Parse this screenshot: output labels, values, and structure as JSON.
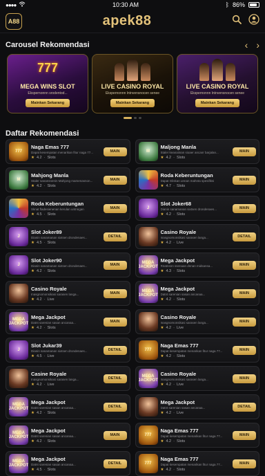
{
  "status_bar": {
    "time": "10:30 AM",
    "battery": "86%"
  },
  "header": {
    "logo_text": "A88",
    "brand": "apek88"
  },
  "carousel": {
    "title": "Carousel Rekomendasi",
    "slides": [
      {
        "title": "MEGA WINS SLOT",
        "subtitle": "Ekspernonnn srodentod...",
        "button": "Mainkan Sekarang",
        "art_text": "777",
        "theme": "slot"
      },
      {
        "title": "LIVE CASINO ROYAL",
        "subtitle": "Ekspernonnn lntnvensnocen senee",
        "button": "Mainkan Sekarang",
        "art_text": "",
        "theme": "casino"
      },
      {
        "title": "LIVE CASINO ROYAL",
        "subtitle": "Ekspernonnn lntnvensnocen senee",
        "button": "Mainkan Sekarang",
        "art_text": "",
        "theme": "casino2"
      }
    ],
    "pages": 3,
    "active_page": 1
  },
  "list": {
    "title": "Daftar Rekomendasi",
    "items": [
      {
        "name": "Naga Emas 777",
        "desc": "Dapat kesempatan menarikan fitur naga 77...",
        "rating": "4.2",
        "category": "Slots",
        "button": "MAIN",
        "thumb": "gold",
        "thumb_text": "777"
      },
      {
        "name": "Maljong Manla",
        "desc": "Staler keanaiinan sioaer ancanr barjalan...",
        "rating": "4.2",
        "category": "Slots",
        "button": "MAIN",
        "thumb": "green",
        "thumb_text": "M"
      },
      {
        "name": "Mahjong Manla",
        "desc": "Staler sanansnenin Mahjong mamenasnon...",
        "rating": "4.2",
        "category": "Slots",
        "button": "MAIN",
        "thumb": "green",
        "thumb_text": "M"
      },
      {
        "name": "Roda Keberuntungan",
        "desc": "Dapat Gliskan unnan mahnta spesifiksi",
        "rating": "4.7",
        "category": "Slots",
        "button": "MAIN",
        "thumb": "wheel",
        "thumb_text": ""
      },
      {
        "name": "Roda Keberuntungan",
        "desc": "Sknat fladesienenan kerulan untnngan",
        "rating": "4.5",
        "category": "Slots",
        "button": "MAIN",
        "thumb": "wheel",
        "thumb_text": ""
      },
      {
        "name": "Slot Joker68",
        "desc": "Dianin sanamanan sixtsen drondenaes...",
        "rating": "4.2",
        "category": "Slots",
        "button": "MAIN",
        "thumb": "purple",
        "thumb_text": "J"
      },
      {
        "name": "Slot Joker89",
        "desc": "Dianin sanamanan sixtsen drondenaes...",
        "rating": "4.5",
        "category": "Slots",
        "button": "DETAIL",
        "thumb": "purple",
        "thumb_text": "J"
      },
      {
        "name": "Casino Royale",
        "desc": "Inasgnomonsikasi sarasen langa...",
        "rating": "4.2",
        "category": "Live",
        "button": "DETAIL",
        "thumb": "casino",
        "thumb_text": ""
      },
      {
        "name": "Slot Joker90",
        "desc": "Dianin sanamanan sixtsen drondenaes...",
        "rating": "4.2",
        "category": "Slots",
        "button": "MAIN",
        "thumb": "purple",
        "thumb_text": "J"
      },
      {
        "name": "Mega Jackpot",
        "desc": "Rnatnsnn ssenaan dnnan midsansa...",
        "rating": "4.3",
        "category": "Slots",
        "button": "MAIN",
        "thumb": "jackpot",
        "thumb_text": "MEGA JACKPOT"
      },
      {
        "name": "Casino Royale",
        "desc": "Inasgnomonsikasi sarasen langa...",
        "rating": "4.2",
        "category": "Live",
        "button": "MAIN",
        "thumb": "casino",
        "thumb_text": ""
      },
      {
        "name": "Mega Jackpot",
        "desc": "Datnt sarenian sasan ancanaa...",
        "rating": "4.2",
        "category": "Slots",
        "button": "MAIN",
        "thumb": "jackpot",
        "thumb_text": "MEGA JACKPOT"
      },
      {
        "name": "Mega Jackpot",
        "desc": "Datnt sarenian sasan ancanaa...",
        "rating": "4.2",
        "category": "Slots",
        "button": "MAIN",
        "thumb": "jackpot",
        "thumb_text": "MEGA JACKPOT"
      },
      {
        "name": "Casino Royale",
        "desc": "Inasgnomonsikasi sarasen langa...",
        "rating": "4.2",
        "category": "Live",
        "button": "MAIN",
        "thumb": "casino",
        "thumb_text": ""
      },
      {
        "name": "Slot Jukar39",
        "desc": "Dianin sanamanan sixtsen drondenaes...",
        "rating": "4.5",
        "category": "Live",
        "button": "DETAIL",
        "thumb": "purple",
        "thumb_text": "J"
      },
      {
        "name": "Naga Emas 777",
        "desc": "Dapat kesempatan menarikan fitur naga 77...",
        "rating": "4.2",
        "category": "Slots",
        "button": "MAIN",
        "thumb": "gold",
        "thumb_text": "777"
      },
      {
        "name": "Casine Royale",
        "desc": "Inasgnomonsikasi sarasen langa...",
        "rating": "4.2",
        "category": "Live",
        "button": "DETAIL",
        "thumb": "casino",
        "thumb_text": ""
      },
      {
        "name": "Casino Royale",
        "desc": "Inasgnomonsikasi sarasen langa...",
        "rating": "4.2",
        "category": "Live",
        "button": "MAIN",
        "thumb": "jackpot",
        "thumb_text": "MEGA JACKPOT"
      },
      {
        "name": "Mega Jackpot",
        "desc": "Datnt sarenian sasan ancanaa...",
        "rating": "4.2",
        "category": "Slots",
        "button": "DETAIL",
        "thumb": "jackpot",
        "thumb_text": "MEGA JACKPOT"
      },
      {
        "name": "Mega Jackpot",
        "desc": "Datnt sarenian sasan ancanaa...",
        "rating": "4.2",
        "category": "Live",
        "button": "DETAIL",
        "thumb": "casino",
        "thumb_text": ""
      },
      {
        "name": "Mega Jackpot",
        "desc": "Datnt sarenian sasan ancanaa...",
        "rating": "4.2",
        "category": "Slots",
        "button": "MAIN",
        "thumb": "jackpot",
        "thumb_text": "MEGA JACKPOT"
      },
      {
        "name": "Naga Emas 777",
        "desc": "Dapat kesempatan menarikan fitur naga 77...",
        "rating": "4.2",
        "category": "Slots",
        "button": "MAIN",
        "thumb": "gold",
        "thumb_text": "777"
      },
      {
        "name": "Mega Jackpot",
        "desc": "Datnt sarenian sasan ancanaa...",
        "rating": "4.5",
        "category": "Slots",
        "button": "DETAIL",
        "thumb": "jackpot",
        "thumb_text": "MEGA JACKPOT"
      },
      {
        "name": "Naga Emas 777",
        "desc": "Dapat kesempatan menarikan fitur naga 77...",
        "rating": "4.2",
        "category": "Slots",
        "button": "MAIN",
        "thumb": "gold",
        "thumb_text": "777"
      }
    ]
  }
}
